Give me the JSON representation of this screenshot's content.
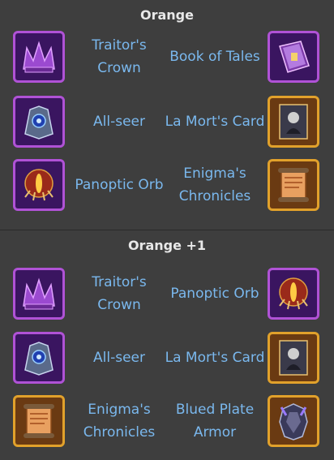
{
  "sections": [
    {
      "title": "Orange",
      "rows": [
        {
          "left": {
            "name": "Traitor's Crown",
            "icon": "traitors-crown-icon"
          },
          "right": {
            "name": "Book of Tales",
            "icon": "book-of-tales-icon"
          }
        },
        {
          "left": {
            "name": "All-seer",
            "icon": "all-seer-icon"
          },
          "right": {
            "name": "La Mort's Card",
            "icon": "la-morts-card-icon"
          }
        },
        {
          "left": {
            "name": "Panoptic Orb",
            "icon": "panoptic-orb-icon"
          },
          "right": {
            "name": "Enigma's Chronicles",
            "icon": "enigmas-chronicles-icon"
          }
        }
      ]
    },
    {
      "title": "Orange +1",
      "rows": [
        {
          "left": {
            "name": "Traitor's Crown",
            "icon": "traitors-crown-icon"
          },
          "right": {
            "name": "Panoptic Orb",
            "icon": "panoptic-orb-icon"
          }
        },
        {
          "left": {
            "name": "All-seer",
            "icon": "all-seer-icon"
          },
          "right": {
            "name": "La Mort's Card",
            "icon": "la-morts-card-icon"
          }
        },
        {
          "left": {
            "name": "Enigma's Chronicles",
            "icon": "enigmas-chronicles-icon"
          },
          "right": {
            "name": "Blued Plate Armor",
            "icon": "blued-plate-armor-icon"
          }
        }
      ]
    }
  ],
  "colors": {
    "background": "#3e3e3e",
    "title": "#e8e8e8",
    "item_label": "#7ab8ee",
    "purple_frame": "#b052d6",
    "orange_frame": "#e1a12b"
  }
}
